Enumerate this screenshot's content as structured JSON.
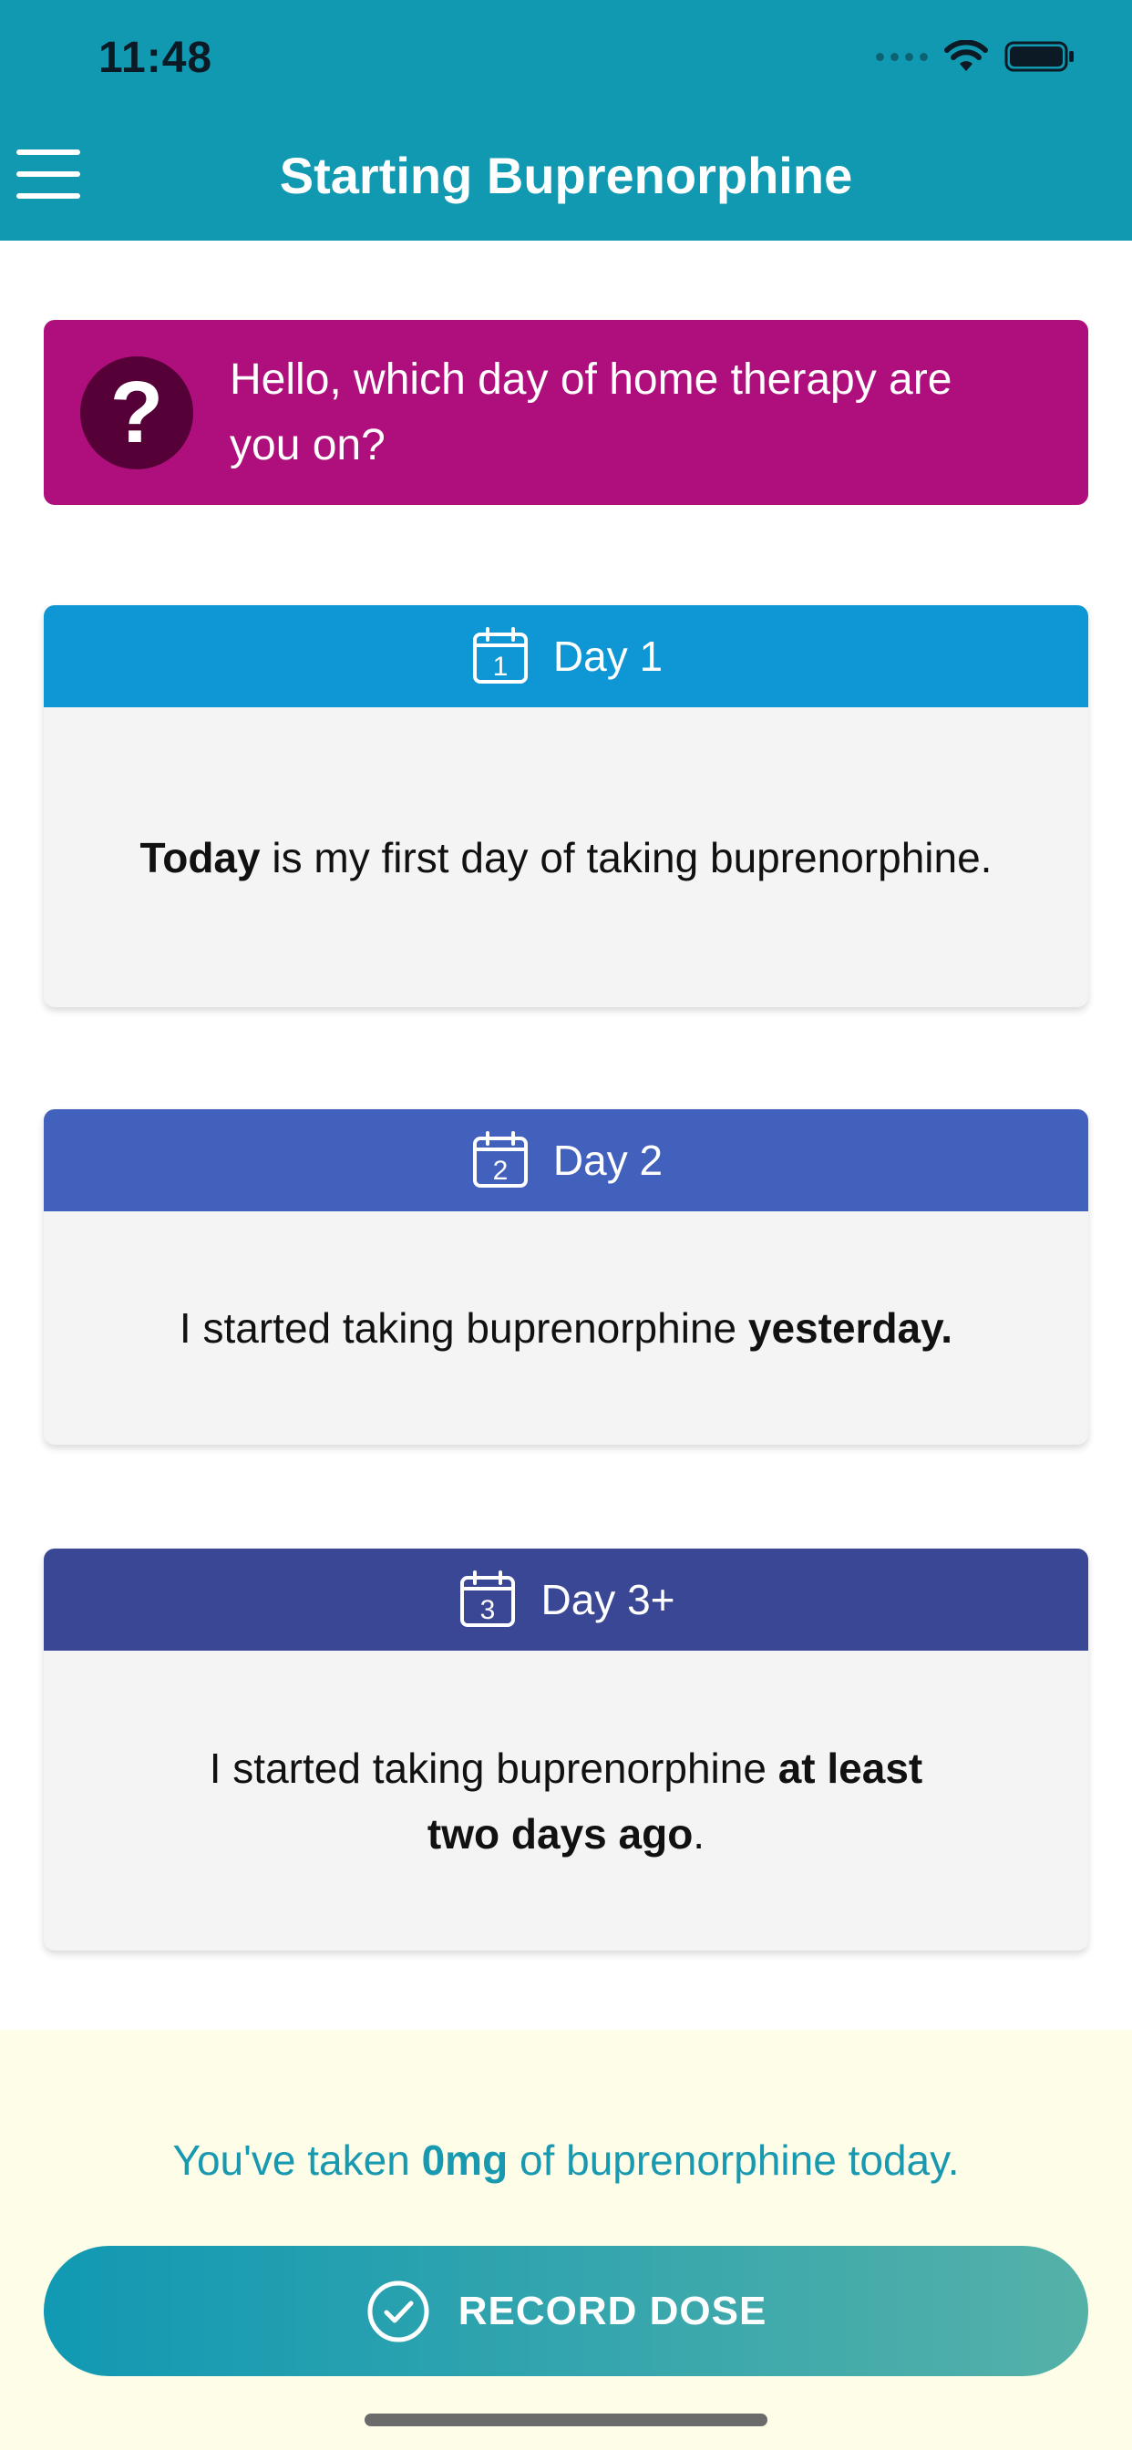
{
  "status_bar": {
    "time": "11:48"
  },
  "header": {
    "title": "Starting Buprenorphine",
    "menu_icon": "hamburger-menu-icon"
  },
  "question": {
    "text": "Hello, which day of home therapy are you on?",
    "icon": "question-mark-icon"
  },
  "days": [
    {
      "label": "Day 1",
      "calendar_number": "1",
      "color": "#0e96d5",
      "body": [
        {
          "text": "Today",
          "bold": true
        },
        {
          "text": " is my first day of taking buprenorphine.",
          "bold": false
        }
      ]
    },
    {
      "label": "Day 2",
      "calendar_number": "2",
      "color": "#4261bc",
      "body": [
        {
          "text": "I started taking buprenorphine ",
          "bold": false
        },
        {
          "text": "yesterday.",
          "bold": true
        }
      ]
    },
    {
      "label": "Day 3+",
      "calendar_number": "3",
      "color": "#3a4794",
      "body": [
        {
          "text": "I started taking buprenorphine ",
          "bold": false
        },
        {
          "text": "at least two days ago",
          "bold": true
        },
        {
          "text": ".",
          "bold": false
        }
      ]
    }
  ],
  "dose_summary": {
    "prefix": "You've taken ",
    "amount": "0mg",
    "suffix": " of buprenorphine today."
  },
  "record_button": {
    "label": "RECORD DOSE",
    "icon": "check-circle-icon"
  },
  "colors": {
    "header": "#1299b2",
    "question_bg": "#ae0f7c",
    "accent_text": "#1899b0"
  }
}
